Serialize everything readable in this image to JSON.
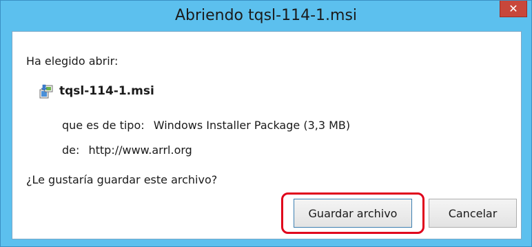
{
  "dialog": {
    "title": "Abriendo tqsl-114-1.msi",
    "close_symbol": "✕"
  },
  "content": {
    "intro": "Ha elegido abrir:",
    "file_name": "tqsl-114-1.msi",
    "file_icon": "installer-package-icon",
    "type_label": "que es de tipo:",
    "type_value": "Windows Installer Package (3,3 MB)",
    "from_label": "de:",
    "from_value": "http://www.arrl.org",
    "question": "¿Le gustaría guardar este archivo?"
  },
  "buttons": {
    "save": "Guardar archivo",
    "cancel": "Cancelar"
  },
  "colors": {
    "titlebar": "#5cc0ee",
    "close_button": "#c8473b",
    "highlight_outline": "#e0001b"
  }
}
